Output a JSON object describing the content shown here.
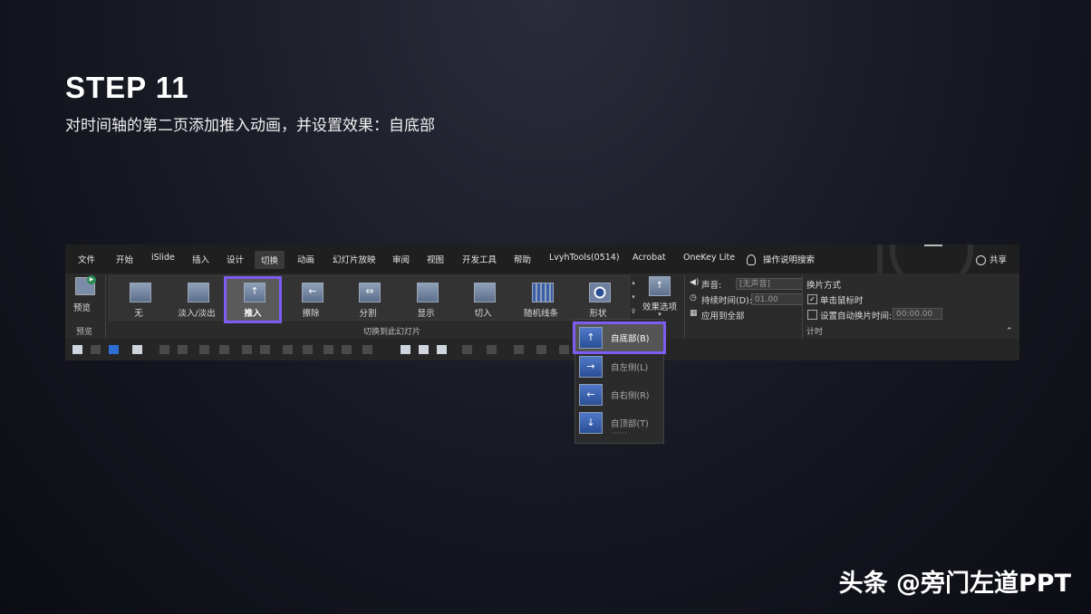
{
  "heading": {
    "title": "STEP 11",
    "subtitle": "对时间轴的第二页添加推入动画，并设置效果：自底部"
  },
  "menu": {
    "items": [
      "文件",
      "开始",
      "iSlide",
      "插入",
      "设计",
      "切换",
      "动画",
      "幻灯片放映",
      "审阅",
      "视图",
      "开发工具",
      "帮助",
      "LvyhTools(0514)",
      "Acrobat",
      "OneKey Lite"
    ],
    "active_index": 5,
    "search": "操作说明搜索",
    "share": "共享"
  },
  "ribbon": {
    "preview_label": "预览",
    "preview_group": "预览",
    "transitions": [
      "无",
      "淡入/淡出",
      "推入",
      "擦除",
      "分割",
      "显示",
      "切入",
      "随机线条",
      "形状"
    ],
    "selected_transition": "推入",
    "transitions_group": "切换到此幻灯片",
    "effect_options": "效果选项",
    "sound_label": "声音:",
    "sound_value": "[无声音]",
    "duration_label": "持续时间(D):",
    "duration_value": "01.00",
    "apply_all": "应用到全部",
    "advance_title": "换片方式",
    "on_click": "单击鼠标时",
    "after_time": "设置自动换片时间:",
    "after_value": "00:00.00",
    "timing_group": "计时"
  },
  "dropdown": {
    "items": [
      "自底部(B)",
      "自左侧(L)",
      "自右侧(R)",
      "自顶部(T)"
    ],
    "selected": "自底部(B)",
    "icons": [
      "arrow-up-icon",
      "arrow-right-icon",
      "arrow-left-icon",
      "arrow-down-icon"
    ]
  },
  "watermark": "头条 @旁门左道PPT",
  "colors": {
    "highlight": "#7d5cf3",
    "ribbon": "#2b2b2b",
    "menubar": "#1f1f1f"
  }
}
